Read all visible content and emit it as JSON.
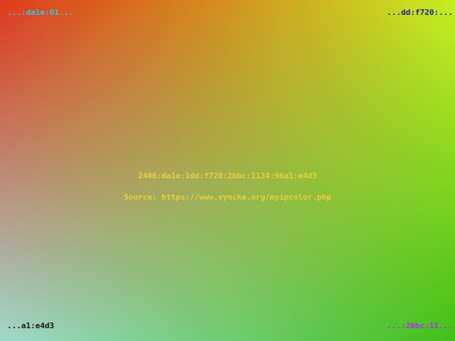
{
  "background": {
    "name": "ip-color-gradient",
    "colors": {
      "top_left": "#e0381c",
      "top_right": "#c8ee22",
      "bottom_left": "#9ed8cc",
      "bottom_right": "#40c018"
    }
  },
  "corners": {
    "top_left": {
      "text": "...:da1e:01...",
      "color": "#38c4f0"
    },
    "top_right": {
      "text": "...dd:f720:...",
      "color": "#1c1ca8"
    },
    "bottom_left": {
      "text": "...a1:e4d3",
      "color": "#141414"
    },
    "bottom_right": {
      "text": "...:2bbc:11...",
      "color": "#b030e8"
    }
  },
  "center": {
    "ip_address": "2406:da1e:1dd:f720:2bbc:1134:96a1:e4d3",
    "source": "Source: https://www.vyncke.org/myipcolor.php",
    "text_color": "#e8d040"
  }
}
